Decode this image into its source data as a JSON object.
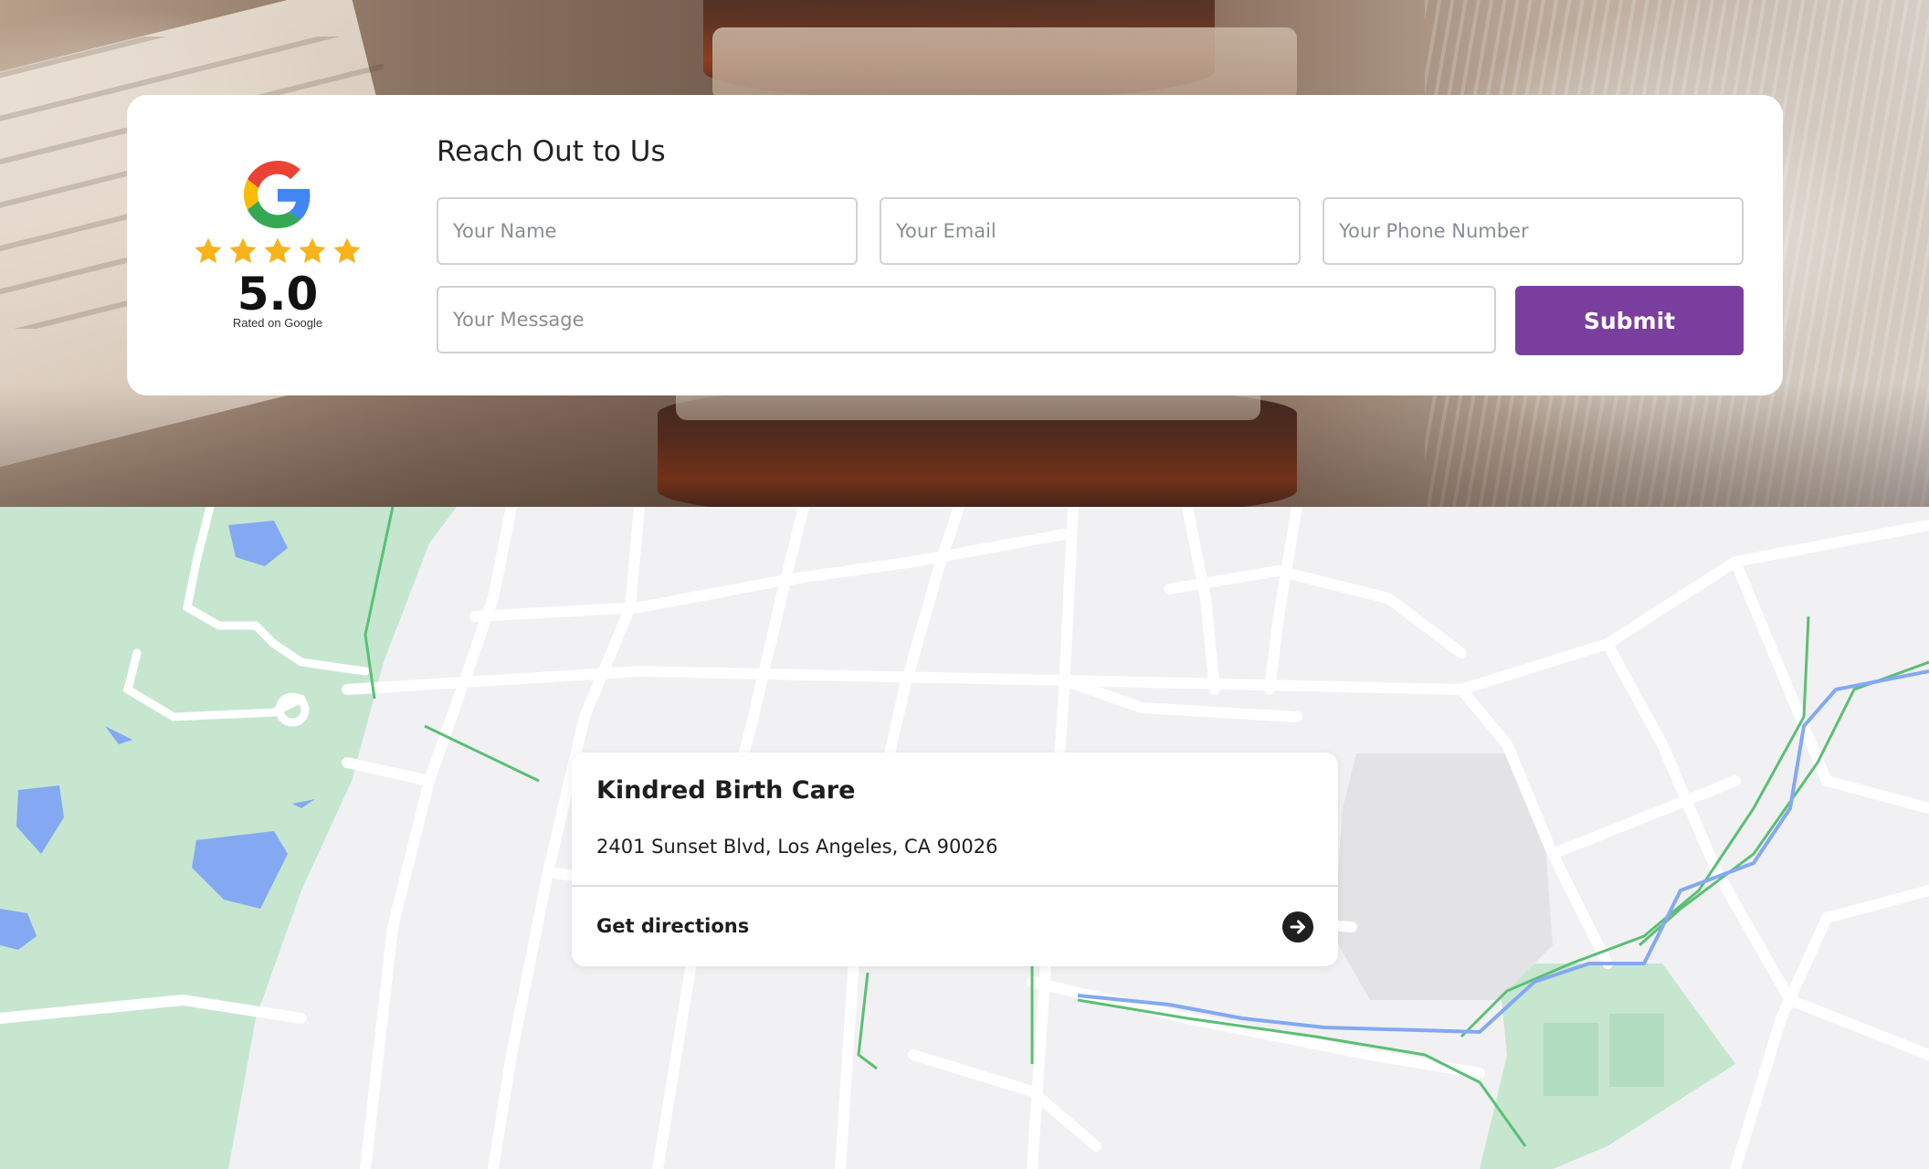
{
  "contact_form": {
    "title": "Reach Out to Us",
    "fields": {
      "name_placeholder": "Your Name",
      "email_placeholder": "Your Email",
      "phone_placeholder": "Your Phone Number",
      "message_placeholder": "Your Message"
    },
    "submit_label": "Submit",
    "submit_color": "#7a3e9e"
  },
  "google_rating": {
    "score": "5.0",
    "stars": 5,
    "caption": "Rated on Google",
    "icon": "google-g-icon",
    "star_color": "#f7b41a"
  },
  "map_card": {
    "business_name": "Kindred Birth Care",
    "address": "2401 Sunset Blvd, Los Angeles, CA 90026",
    "directions_label": "Get directions",
    "directions_icon": "arrow-right-circle-icon"
  },
  "colors": {
    "map_background": "#f1f1f3",
    "park_green": "#c6e6d0",
    "water_blue": "#84a8f2",
    "trail_green": "#5bbf75"
  }
}
